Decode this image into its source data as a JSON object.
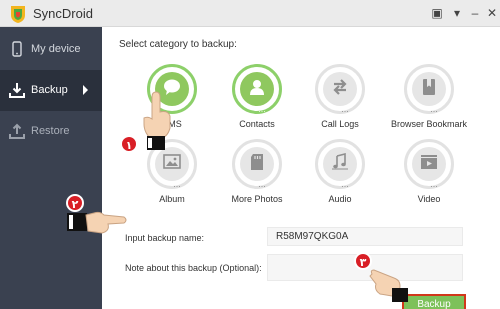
{
  "app": {
    "title": "SyncDroid"
  },
  "window_buttons": {
    "settings": "▣",
    "menu": "▾",
    "minimize": "–",
    "close": "✕"
  },
  "sidebar": {
    "items": [
      {
        "label": "My device",
        "icon": "phone-icon"
      },
      {
        "label": "Backup",
        "icon": "download-icon",
        "active": true
      },
      {
        "label": "Restore",
        "icon": "upload-icon"
      }
    ]
  },
  "main": {
    "heading": "Select category to backup:",
    "categories": [
      {
        "label": "SMS",
        "icon": "chat-bubble-icon",
        "selected": true,
        "dots": "..."
      },
      {
        "label": "Contacts",
        "icon": "person-icon",
        "selected": true,
        "dots": "..."
      },
      {
        "label": "Call Logs",
        "icon": "arrows-icon",
        "selected": false,
        "dots": "..."
      },
      {
        "label": "Browser Bookmark",
        "icon": "bookmark-icon",
        "selected": false,
        "dots": "..."
      },
      {
        "label": "Album",
        "icon": "image-icon",
        "selected": false,
        "dots": "..."
      },
      {
        "label": "More Photos",
        "icon": "sd-card-icon",
        "selected": false,
        "dots": "..."
      },
      {
        "label": "Audio",
        "icon": "music-icon",
        "selected": false,
        "dots": "..."
      },
      {
        "label": "Video",
        "icon": "video-icon",
        "selected": false,
        "dots": "..."
      }
    ],
    "backup_name_label": "Input backup name:",
    "backup_name_value": "R58M97QKG0A",
    "note_label": "Note about this backup (Optional):",
    "note_value": "",
    "backup_button": "Backup"
  },
  "annotations": {
    "badge1": "١",
    "badge2": "٢",
    "badge3": "٣"
  },
  "colors": {
    "selected_green": "#8fc85f",
    "sidebar_bg": "#3a4150",
    "badge_red": "#d91f26"
  }
}
